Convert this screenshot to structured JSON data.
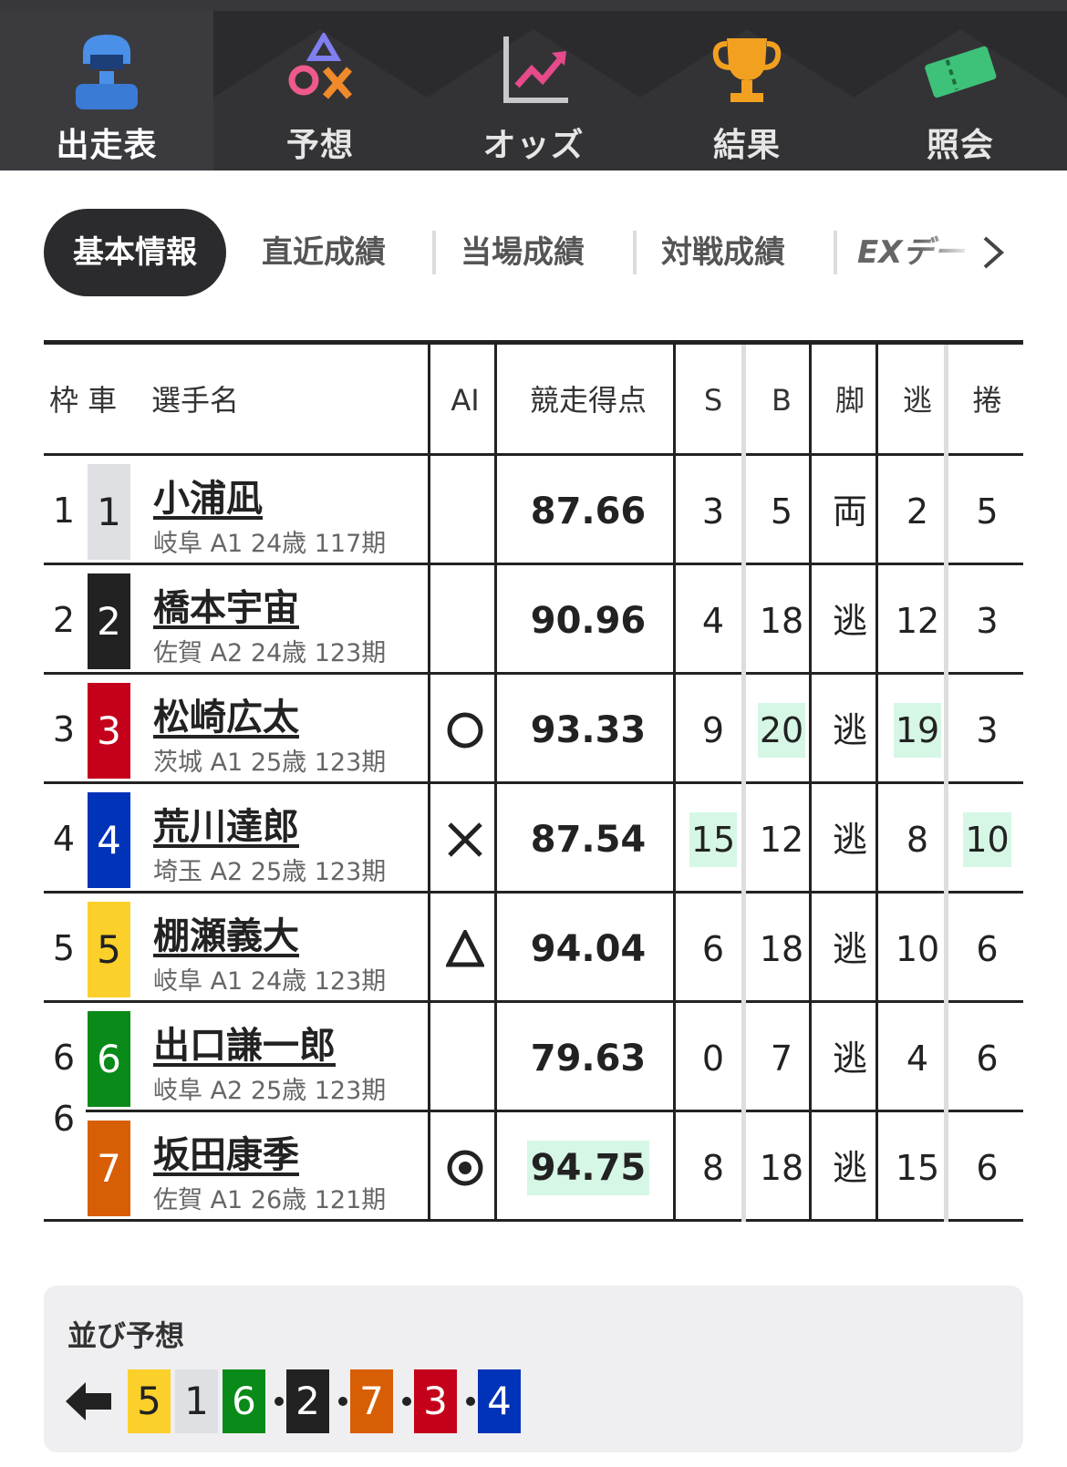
{
  "nav": {
    "tabs": [
      {
        "label": "出走表",
        "icon": "rider-icon",
        "active": true
      },
      {
        "label": "予想",
        "icon": "prediction-symbols-icon",
        "active": false
      },
      {
        "label": "オッズ",
        "icon": "odds-chart-icon",
        "active": false
      },
      {
        "label": "結果",
        "icon": "trophy-icon",
        "active": false
      },
      {
        "label": "照会",
        "icon": "ticket-icon",
        "active": false
      }
    ]
  },
  "subtabs": [
    {
      "label": "基本情報",
      "active": true
    },
    {
      "label": "直近成績",
      "active": false
    },
    {
      "label": "当場成績",
      "active": false
    },
    {
      "label": "対戦成績",
      "active": false
    },
    {
      "label": "EXデー",
      "active": false
    }
  ],
  "table": {
    "headers": {
      "waku_sha": "枠 車",
      "name": "選手名",
      "ai": "AI",
      "score": "競走得点",
      "s": "S",
      "b": "B",
      "kyaku": "脚",
      "nige": "逃",
      "makuri": "捲"
    },
    "rows": [
      {
        "waku": "1",
        "car": "1",
        "color": "#dfe0e4",
        "textColor": "#222222",
        "name": "小浦凪",
        "info": "岐阜 A1 24歳 117期",
        "ai": "",
        "score": "87.66",
        "s": "3",
        "b": "5",
        "kyaku": "両",
        "nige": "2",
        "makuri": "5",
        "hl": []
      },
      {
        "waku": "2",
        "car": "2",
        "color": "#222222",
        "textColor": "#ffffff",
        "name": "橋本宇宙",
        "info": "佐賀 A2 24歳 123期",
        "ai": "",
        "score": "90.96",
        "s": "4",
        "b": "18",
        "kyaku": "逃",
        "nige": "12",
        "makuri": "3",
        "hl": []
      },
      {
        "waku": "3",
        "car": "3",
        "color": "#c4001a",
        "textColor": "#ffffff",
        "name": "松崎広太",
        "info": "茨城 A1 25歳 123期",
        "ai": "circle",
        "score": "93.33",
        "s": "9",
        "b": "20",
        "kyaku": "逃",
        "nige": "19",
        "makuri": "3",
        "hl": [
          "b",
          "nige"
        ]
      },
      {
        "waku": "4",
        "car": "4",
        "color": "#0033b8",
        "textColor": "#ffffff",
        "name": "荒川達郎",
        "info": "埼玉 A2 25歳 123期",
        "ai": "cross",
        "score": "87.54",
        "s": "15",
        "b": "12",
        "kyaku": "逃",
        "nige": "8",
        "makuri": "10",
        "hl": [
          "s",
          "makuri"
        ]
      },
      {
        "waku": "5",
        "car": "5",
        "color": "#fcd02a",
        "textColor": "#222222",
        "name": "棚瀬義大",
        "info": "岐阜 A1 24歳 123期",
        "ai": "triangle",
        "score": "94.04",
        "s": "6",
        "b": "18",
        "kyaku": "逃",
        "nige": "10",
        "makuri": "6",
        "hl": []
      },
      {
        "waku": "6",
        "car": "6",
        "color": "#0a8a18",
        "textColor": "#ffffff",
        "name": "出口謙一郎",
        "info": "岐阜 A2 25歳 123期",
        "ai": "",
        "score": "79.63",
        "s": "0",
        "b": "7",
        "kyaku": "逃",
        "nige": "4",
        "makuri": "6",
        "hl": []
      },
      {
        "waku": "",
        "car": "7",
        "color": "#d85e05",
        "textColor": "#ffffff",
        "name": "坂田康季",
        "info": "佐賀 A1 26歳 121期",
        "ai": "double-circle",
        "score": "94.75",
        "s": "8",
        "b": "18",
        "kyaku": "逃",
        "nige": "15",
        "makuri": "6",
        "hl": [
          "score"
        ]
      }
    ],
    "waku6_label": "6"
  },
  "narabi": {
    "title": "並び予想",
    "arrow_icon": "left-arrow-icon",
    "groups": [
      [
        "5",
        "1",
        "6"
      ],
      [
        "2"
      ],
      [
        "7"
      ],
      [
        "3"
      ],
      [
        "4"
      ]
    ],
    "colors": {
      "1": "#dfe0e4",
      "2": "#222222",
      "3": "#c4001a",
      "4": "#0033b8",
      "5": "#fcd02a",
      "6": "#0a8a18",
      "7": "#d85e05"
    }
  }
}
